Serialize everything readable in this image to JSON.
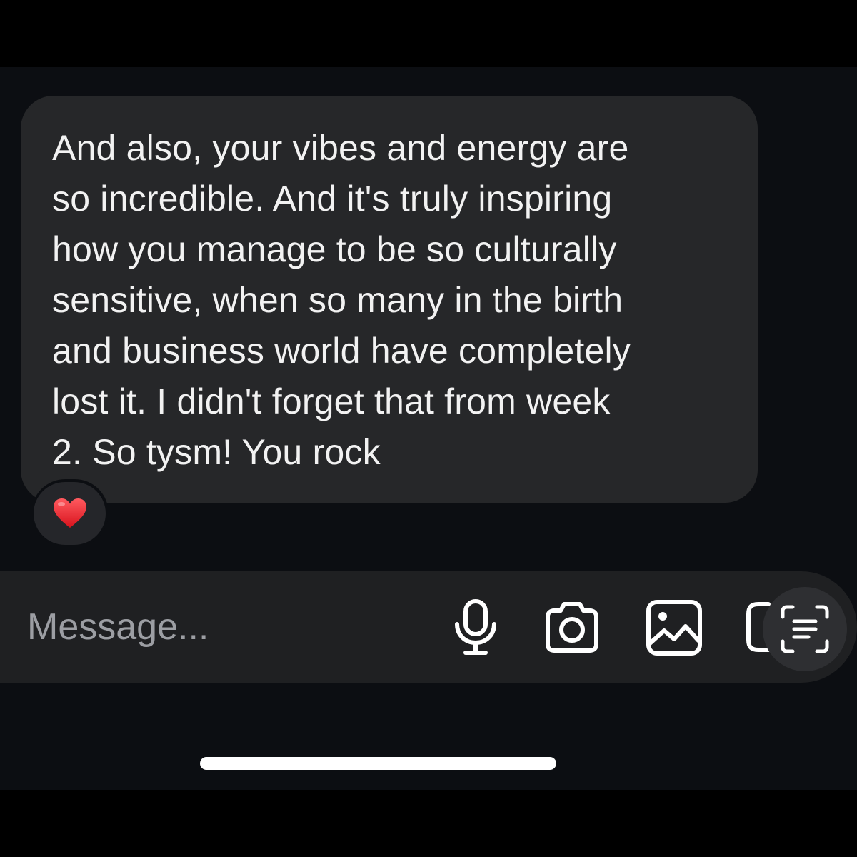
{
  "message": {
    "text": "And also, your vibes and energy are\nso incredible. And it's truly inspiring\nhow you manage to be so culturally\nsensitive, when so many in the birth\nand business world have completely\nlost it. I didn't forget that from week\n2. So tysm! You rock",
    "reaction": "heart-emoji"
  },
  "composer": {
    "placeholder": "Message...",
    "icons": [
      "microphone-icon",
      "camera-icon",
      "gallery-icon",
      "sticker-icon",
      "text-scan-icon"
    ]
  },
  "colors": {
    "background": "#0c0e12",
    "bubble": "#262729",
    "composer": "#1f2022",
    "heart": "#e4202a"
  }
}
